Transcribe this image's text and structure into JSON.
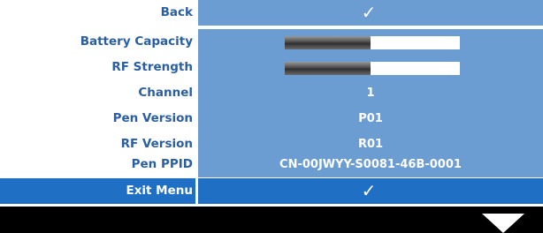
{
  "menu": {
    "rows": [
      {
        "label": "Back",
        "value": "✓"
      },
      {
        "label": "Battery Capacity",
        "level": 0.49
      },
      {
        "label": "RF Strength",
        "level": 0.49
      },
      {
        "label": "Channel",
        "value": "1"
      },
      {
        "label": "Pen Version",
        "value": "P01"
      },
      {
        "label": "RF Version",
        "value": "R01"
      },
      {
        "label": "Pen PPID",
        "value": "CN-00JWYY-S0081-46B-0001"
      }
    ],
    "exit": {
      "label": "Exit Menu",
      "value": "✓"
    }
  },
  "footer": {
    "icon": "scroll-down-triangle-icon"
  },
  "colors": {
    "label_text": "#2a5ea3",
    "value_bg": "#6b9dd2",
    "selected_bg": "#1f6fc4",
    "footer_bg": "#000000"
  }
}
